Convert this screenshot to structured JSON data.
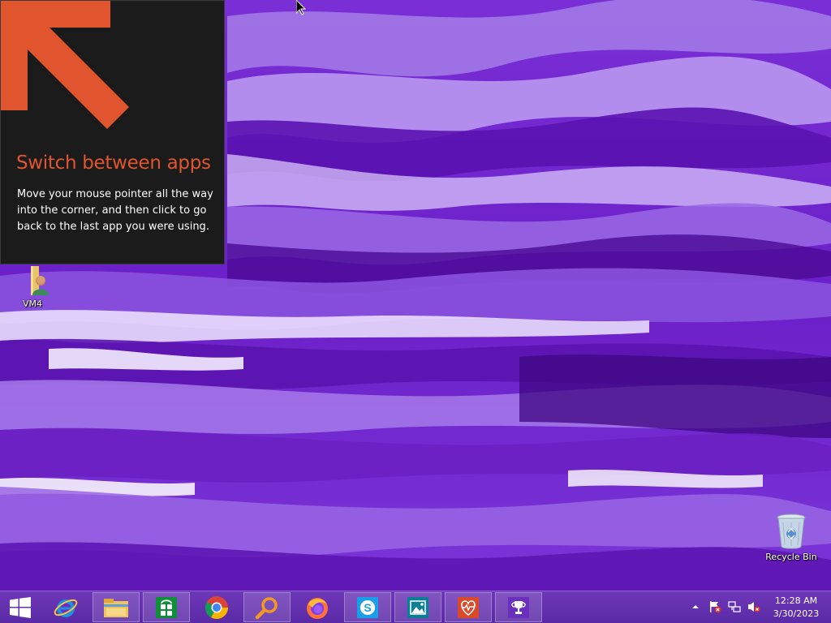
{
  "tip": {
    "title": "Switch between apps",
    "body": "Move your mouse pointer all the way into the corner, and then click to go back to the last app you were using.",
    "accent_color": "#e0552e"
  },
  "desktop": {
    "icons": [
      {
        "label": "VM4",
        "icon": "user-folder-icon"
      },
      {
        "label": "Recycle Bin",
        "icon": "recycle-bin-icon"
      }
    ]
  },
  "taskbar": {
    "start_icon": "windows-logo-icon",
    "apps": [
      {
        "name": "Internet Explorer",
        "icon": "internet-explorer-icon"
      },
      {
        "name": "File Explorer",
        "icon": "file-explorer-icon"
      },
      {
        "name": "Store",
        "icon": "store-icon"
      },
      {
        "name": "Chrome",
        "icon": "chrome-icon"
      },
      {
        "name": "Search",
        "icon": "magnifier-icon"
      },
      {
        "name": "Firefox",
        "icon": "firefox-icon"
      },
      {
        "name": "Skype",
        "icon": "skype-icon"
      },
      {
        "name": "Photos",
        "icon": "photos-icon"
      },
      {
        "name": "Health",
        "icon": "health-icon"
      },
      {
        "name": "Trophy",
        "icon": "trophy-icon"
      }
    ],
    "tray": {
      "icons": [
        "show-hidden-icons-chevron",
        "action-center-flag-icon",
        "network-icon",
        "volume-muted-icon"
      ],
      "time": "12:28 AM",
      "date": "3/30/2023"
    }
  }
}
